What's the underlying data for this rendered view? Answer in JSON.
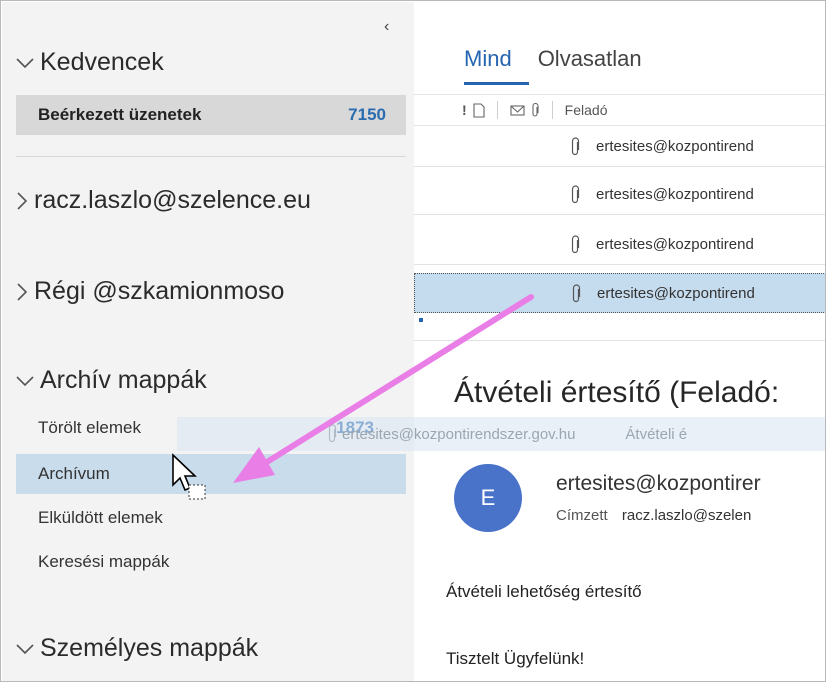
{
  "folder_pane": {
    "favorites_header": "Kedvencek",
    "inbox_label": "Beérkezett üzenetek",
    "inbox_count": "7150",
    "account1": "racz.laszlo@szelence.eu",
    "account2": "Régi @szkamionmoso",
    "archive_header": "Archív mappák",
    "deleted_label": "Törölt elemek",
    "deleted_count": "1873",
    "archive_label": "Archívum",
    "sent_label": "Elküldött elemek",
    "search_label": "Keresési mappák",
    "personal_header": "Személyes mappák"
  },
  "mail_list": {
    "tab_all": "Mind",
    "tab_unread": "Olvasatlan",
    "col_from": "Feladó",
    "rows": [
      {
        "sender": "ertesites@kozpontirend"
      },
      {
        "sender": "ertesites@kozpontirend"
      },
      {
        "sender": "ertesites@kozpontirend"
      },
      {
        "sender": "ertesites@kozpontirend"
      }
    ]
  },
  "reading_pane": {
    "subject": "Átvételi értesítő (Feladó:",
    "avatar_initial": "E",
    "from": "ertesites@kozpontirer",
    "to_label": "Címzett",
    "to_addr": "racz.laszlo@szelen",
    "body_line1": "Átvételi lehetőség értesítő",
    "body_line2": "Tisztelt Ügyfelünk!"
  },
  "drag_ghost": {
    "sender": "ertesites@kozpontirendszer.gov.hu",
    "subject": "Átvételi é"
  },
  "colors": {
    "accent": "#2564b0",
    "avatar": "#4972c9",
    "arrow": "#e97ee6",
    "selected_row": "#c5dbee"
  }
}
